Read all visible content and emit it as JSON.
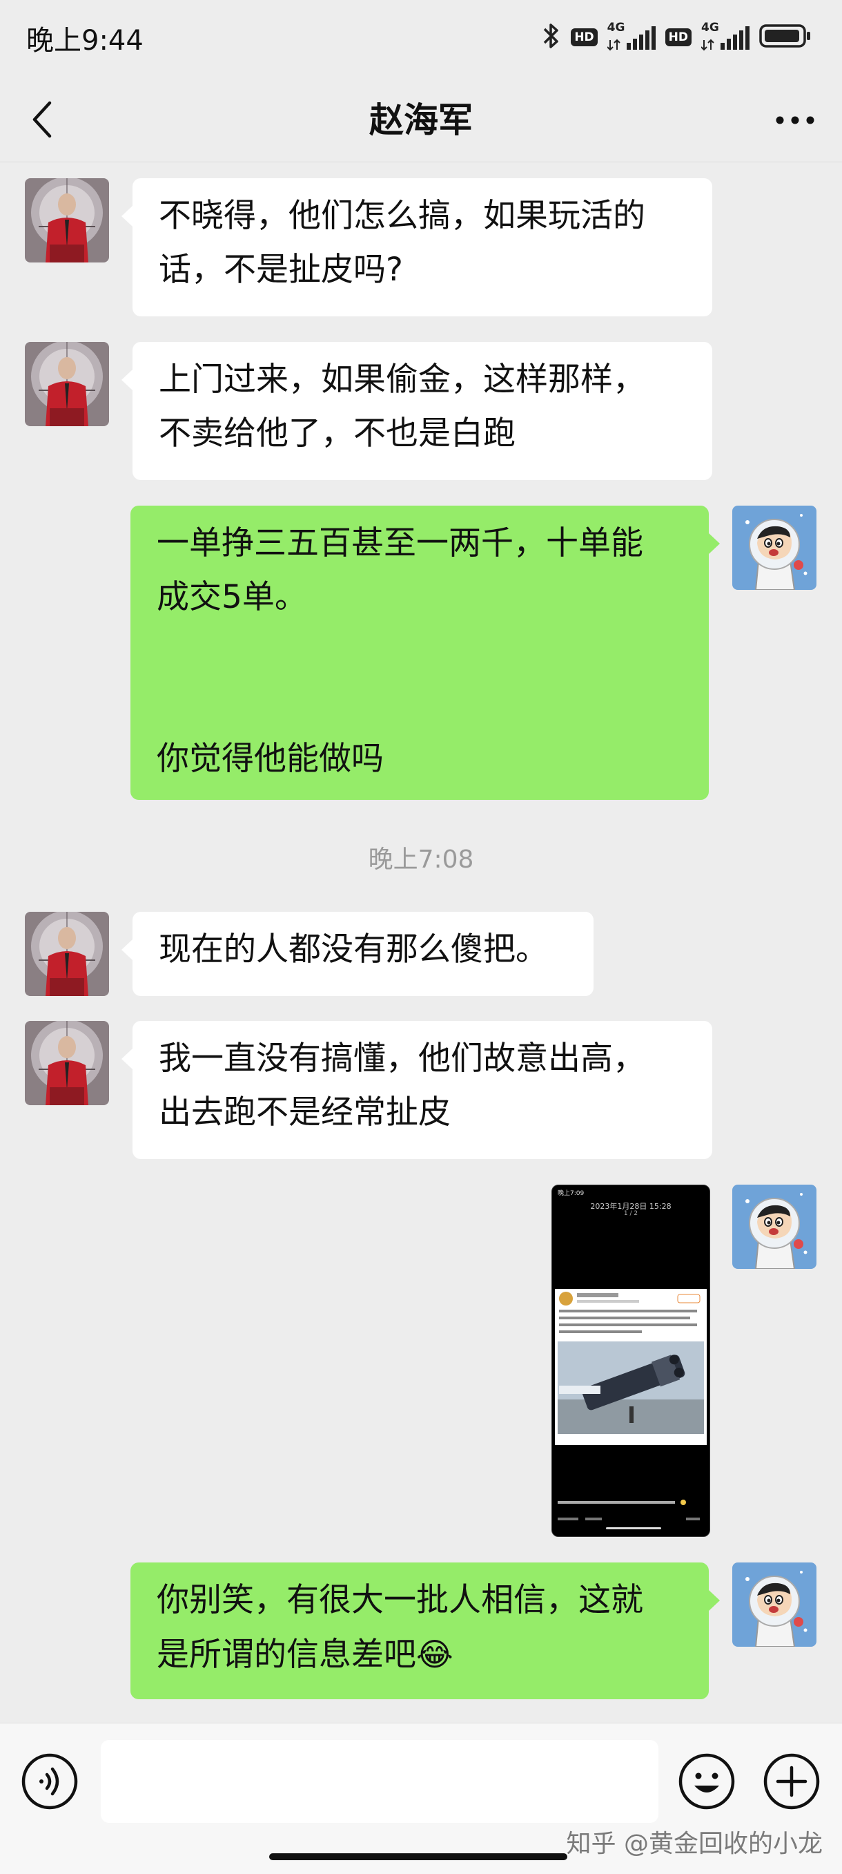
{
  "status_bar": {
    "time": "晚上9:44",
    "hd_label": "HD",
    "network_label": "4G"
  },
  "nav": {
    "title": "赵海军"
  },
  "messages": [
    {
      "side": "in",
      "text": "不晓得，他们怎么搞，如果玩活的\n话，不是扯皮吗?"
    },
    {
      "side": "in",
      "text": "上门过来，如果偷金，这样那样，\n不卖给他了，不也是白跑"
    },
    {
      "side": "out",
      "text": "一单挣三五百甚至一两千，十单能\n成交5单。\n\n\n你觉得他能做吗"
    },
    {
      "side": "in",
      "text": "现在的人都没有那么傻把。"
    },
    {
      "side": "in",
      "text": "我一直没有搞懂，他们故意出高，\n出去跑不是经常扯皮"
    },
    {
      "side": "out",
      "text": "你别笑，有很大一批人相信，这就\n是所谓的信息差吧"
    }
  ],
  "timestamp": "晚上7:08",
  "shared_image": {
    "status_time": "晚上7:09",
    "date": "2023年1月28日 15:28",
    "page": "1 / 2"
  },
  "emoji": "😂",
  "watermark": "知乎 @黄金回收的小龙",
  "colors": {
    "background": "#ededed",
    "incoming_bubble": "#ffffff",
    "outgoing_bubble": "#95ec69"
  }
}
